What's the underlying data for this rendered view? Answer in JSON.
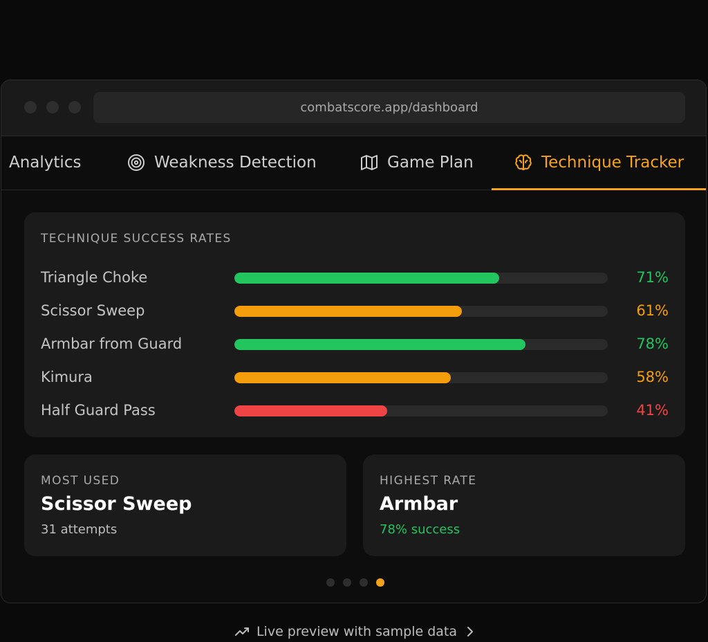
{
  "browser": {
    "url": "combatscore.app/dashboard"
  },
  "tabs": [
    {
      "label": "Analytics",
      "icon": "",
      "active": false
    },
    {
      "label": "Weakness Detection",
      "icon": "target-icon",
      "active": false
    },
    {
      "label": "Game Plan",
      "icon": "map-icon",
      "active": false
    },
    {
      "label": "Technique Tracker",
      "icon": "brain-icon",
      "active": true
    }
  ],
  "rates": {
    "title": "TECHNIQUE SUCCESS RATES",
    "items": [
      {
        "label": "Triangle Choke",
        "value_text": "71%",
        "value": 0.71,
        "color": "#22c55e"
      },
      {
        "label": "Scissor Sweep",
        "value_text": "61%",
        "value": 0.61,
        "color": "#f59e0b"
      },
      {
        "label": "Armbar from Guard",
        "value_text": "78%",
        "value": 0.78,
        "color": "#22c55e"
      },
      {
        "label": "Kimura",
        "value_text": "58%",
        "value": 0.58,
        "color": "#f59e0b"
      },
      {
        "label": "Half Guard Pass",
        "value_text": "41%",
        "value": 0.41,
        "color": "#ef4444"
      }
    ]
  },
  "most_used": {
    "kicker": "MOST USED",
    "title": "Scissor Sweep",
    "subtitle": "31 attempts"
  },
  "highest_rate": {
    "kicker": "HIGHEST RATE",
    "title": "Armbar",
    "subtitle": "78% success",
    "subtitle_color": "#22c55e"
  },
  "pager": {
    "count": 4,
    "active_index": 3
  },
  "footer": {
    "label": "Live preview with sample data"
  },
  "colors": {
    "accent": "#f5a21c",
    "success": "#22c55e",
    "warning": "#f59e0b",
    "danger": "#ef4444"
  }
}
